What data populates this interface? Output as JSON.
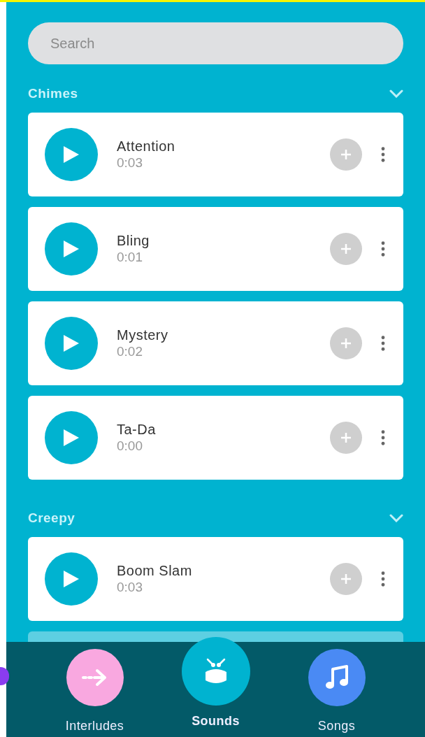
{
  "search": {
    "placeholder": "Search"
  },
  "sections": [
    {
      "title": "Chimes",
      "expanded": true,
      "sounds": [
        {
          "name": "Attention",
          "duration": "0:03"
        },
        {
          "name": "Bling",
          "duration": "0:01"
        },
        {
          "name": "Mystery",
          "duration": "0:02"
        },
        {
          "name": "Ta-Da",
          "duration": "0:00"
        }
      ]
    },
    {
      "title": "Creepy",
      "expanded": true,
      "sounds": [
        {
          "name": "Boom Slam",
          "duration": "0:03"
        }
      ]
    }
  ],
  "nav": [
    {
      "kind": "interludes",
      "label": "Interludes",
      "selected": false,
      "color": "#f9a8e0"
    },
    {
      "kind": "sounds",
      "label": "Sounds",
      "selected": true,
      "color": "#00b3d0"
    },
    {
      "kind": "songs",
      "label": "Songs",
      "selected": false,
      "color": "#4a8af4"
    }
  ]
}
